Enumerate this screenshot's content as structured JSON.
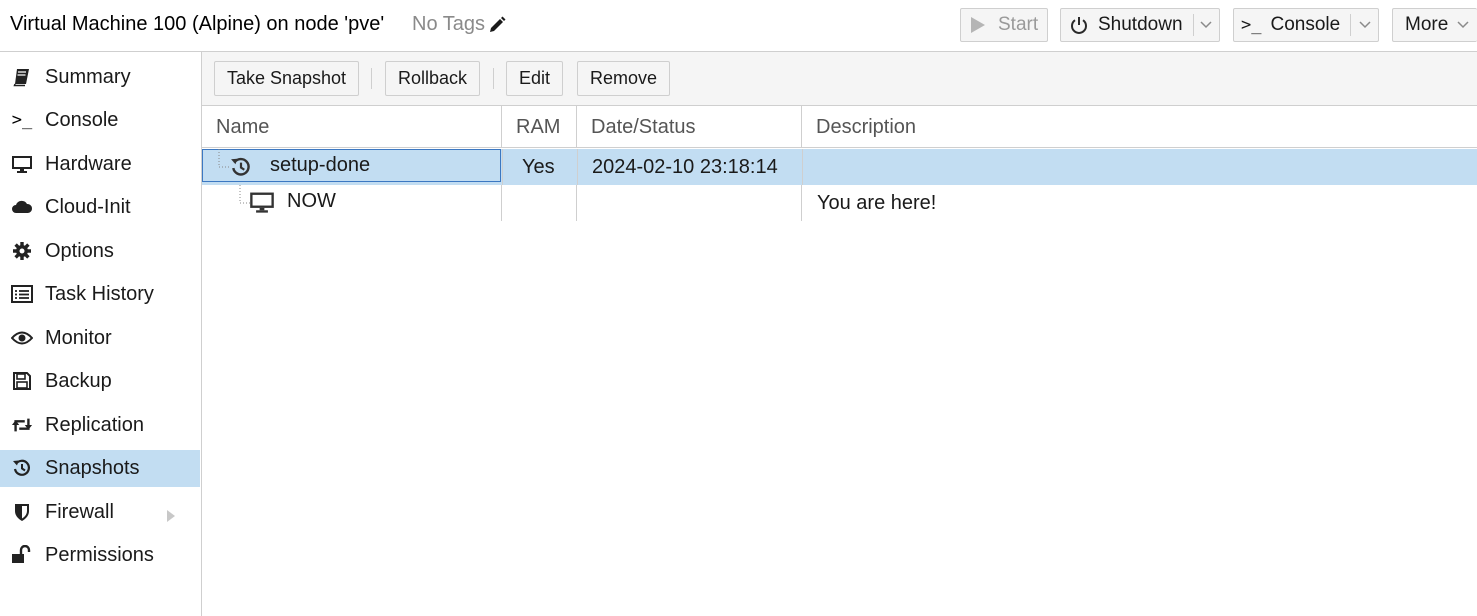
{
  "header": {
    "title": "Virtual Machine 100 (Alpine) on node 'pve'",
    "tags_label": "No Tags",
    "start_label": "Start",
    "shutdown_label": "Shutdown",
    "console_label": "Console",
    "more_label": "More"
  },
  "sidebar": {
    "items": [
      {
        "label": "Summary",
        "icon": "book-icon"
      },
      {
        "label": "Console",
        "icon": "terminal-icon"
      },
      {
        "label": "Hardware",
        "icon": "desktop-icon"
      },
      {
        "label": "Cloud-Init",
        "icon": "cloud-icon"
      },
      {
        "label": "Options",
        "icon": "gear-icon"
      },
      {
        "label": "Task History",
        "icon": "list-icon"
      },
      {
        "label": "Monitor",
        "icon": "eye-icon"
      },
      {
        "label": "Backup",
        "icon": "floppy-icon"
      },
      {
        "label": "Replication",
        "icon": "retweet-icon"
      },
      {
        "label": "Snapshots",
        "icon": "history-icon",
        "active": true
      },
      {
        "label": "Firewall",
        "icon": "shield-icon"
      },
      {
        "label": "Permissions",
        "icon": "unlock-icon"
      }
    ]
  },
  "toolbar": {
    "take_snapshot": "Take Snapshot",
    "rollback": "Rollback",
    "edit": "Edit",
    "remove": "Remove"
  },
  "grid": {
    "columns": [
      "Name",
      "RAM",
      "Date/Status",
      "Description"
    ],
    "rows": [
      {
        "name": "setup-done",
        "ram": "Yes",
        "date": "2024-02-10 23:18:14",
        "description": "",
        "icon": "history-icon",
        "selected": true
      },
      {
        "name": "NOW",
        "ram": "",
        "date": "",
        "description": "You are here!",
        "icon": "desktop-icon",
        "selected": false
      }
    ]
  },
  "colors": {
    "selection": "#c2ddf2",
    "border": "#cfcfcf",
    "focus": "#3c78c2"
  }
}
